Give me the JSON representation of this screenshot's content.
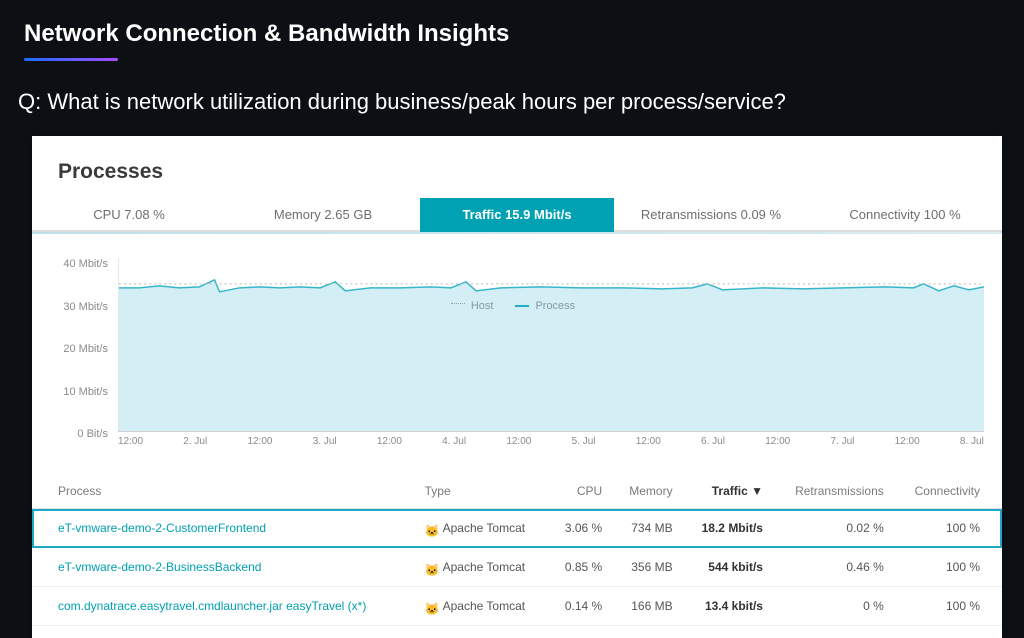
{
  "header": {
    "title": "Network Connection & Bandwidth Insights",
    "question": "Q: What is network utilization during business/peak hours per process/service?"
  },
  "panel": {
    "title": "Processes"
  },
  "tabs": [
    {
      "label": "CPU 7.08 %",
      "active": false
    },
    {
      "label": "Memory 2.65 GB",
      "active": false
    },
    {
      "label": "Traffic 15.9 Mbit/s",
      "active": true
    },
    {
      "label": "Retransmissions 0.09 %",
      "active": false
    },
    {
      "label": "Connectivity 100 %",
      "active": false
    }
  ],
  "chart_data": {
    "type": "area",
    "title": "",
    "ylabel": "Mbit/s",
    "ylim": [
      0,
      40
    ],
    "yticks": [
      "0 Bit/s",
      "10 Mbit/s",
      "20 Mbit/s",
      "30 Mbit/s",
      "40 Mbit/s"
    ],
    "xticks": [
      "12:00",
      "2. Jul",
      "12:00",
      "3. Jul",
      "12:00",
      "4. Jul",
      "12:00",
      "5. Jul",
      "12:00",
      "6. Jul",
      "12:00",
      "7. Jul",
      "12:00",
      "8. Jul"
    ],
    "series": [
      {
        "name": "Process",
        "approx_value_mbits": 34,
        "style": "solid",
        "color": "#00a1b2"
      },
      {
        "name": "Host",
        "approx_value_mbits": 35,
        "style": "dotted",
        "color": "#9aa0a6"
      }
    ],
    "legend": {
      "host": "Host",
      "process": "Process"
    }
  },
  "table": {
    "columns": {
      "process": "Process",
      "type": "Type",
      "cpu": "CPU",
      "memory": "Memory",
      "traffic": "Traffic ▼",
      "retransmissions": "Retransmissions",
      "connectivity": "Connectivity"
    },
    "rows": [
      {
        "process": "eT-vmware-demo-2-CustomerFrontend",
        "type": "Apache Tomcat",
        "cpu": "3.06 %",
        "memory": "734 MB",
        "traffic": "18.2 Mbit/s",
        "retransmissions": "0.02 %",
        "connectivity": "100 %",
        "selected": true
      },
      {
        "process": "eT-vmware-demo-2-BusinessBackend",
        "type": "Apache Tomcat",
        "cpu": "0.85 %",
        "memory": "356 MB",
        "traffic": "544 kbit/s",
        "retransmissions": "0.46 %",
        "connectivity": "100 %",
        "selected": false
      },
      {
        "process": "com.dynatrace.easytravel.cmdlauncher.jar easyTravel (x*)",
        "type": "Apache Tomcat",
        "cpu": "0.14 %",
        "memory": "166 MB",
        "traffic": "13.4 kbit/s",
        "retransmissions": "0 %",
        "connectivity": "100 %",
        "selected": false
      }
    ]
  }
}
